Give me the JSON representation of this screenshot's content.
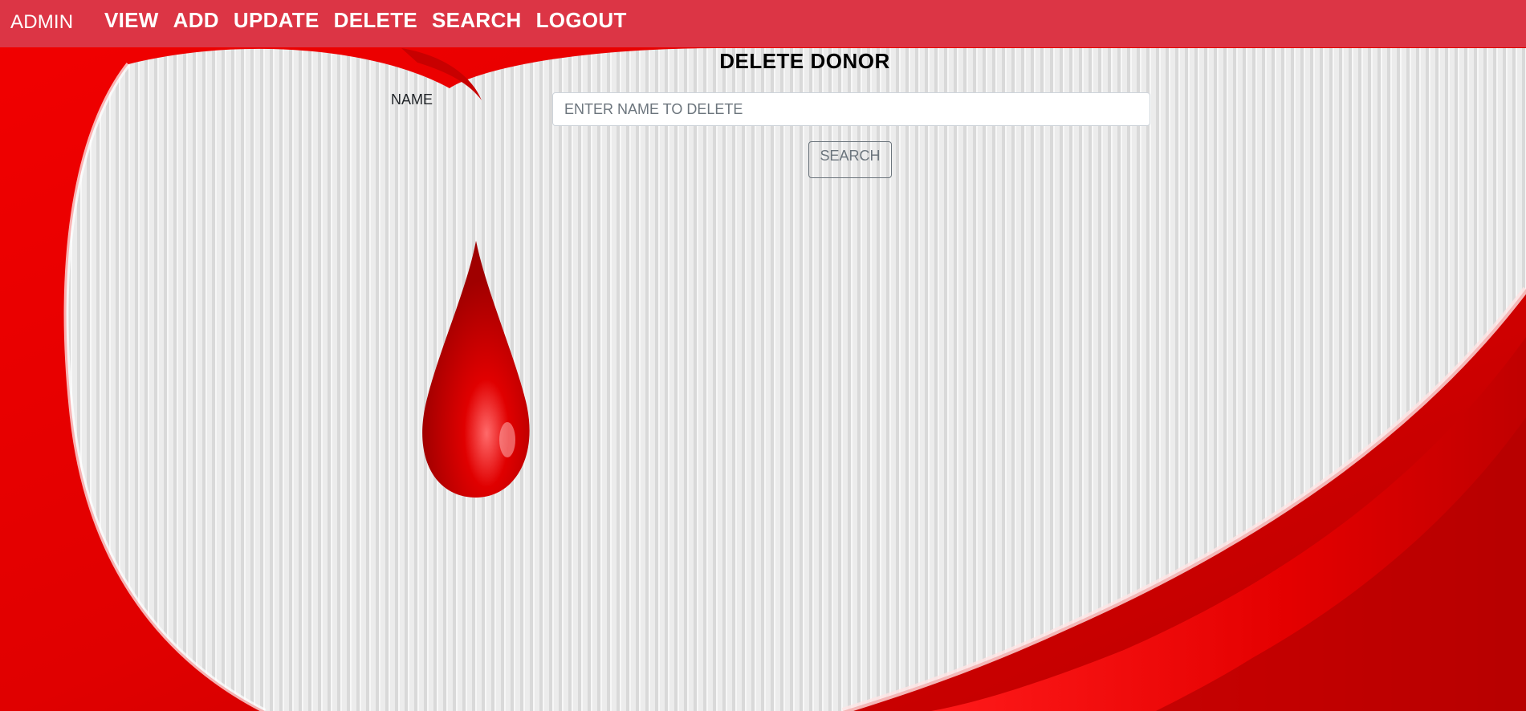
{
  "navbar": {
    "brand": "ADMIN",
    "links": [
      "VIEW",
      "ADD",
      "UPDATE",
      "DELETE",
      "SEARCH",
      "LOGOUT"
    ],
    "background_color": "#dc3545"
  },
  "form": {
    "title": "DELETE DONOR",
    "name_label": "NAME",
    "name_placeholder": "ENTER NAME TO DELETE",
    "name_value": "",
    "search_button": "SEARCH"
  },
  "background": {
    "description_icon": "blood-drop-icon",
    "accent_color": "#e00000",
    "pattern_color": "#e6e6e6"
  }
}
